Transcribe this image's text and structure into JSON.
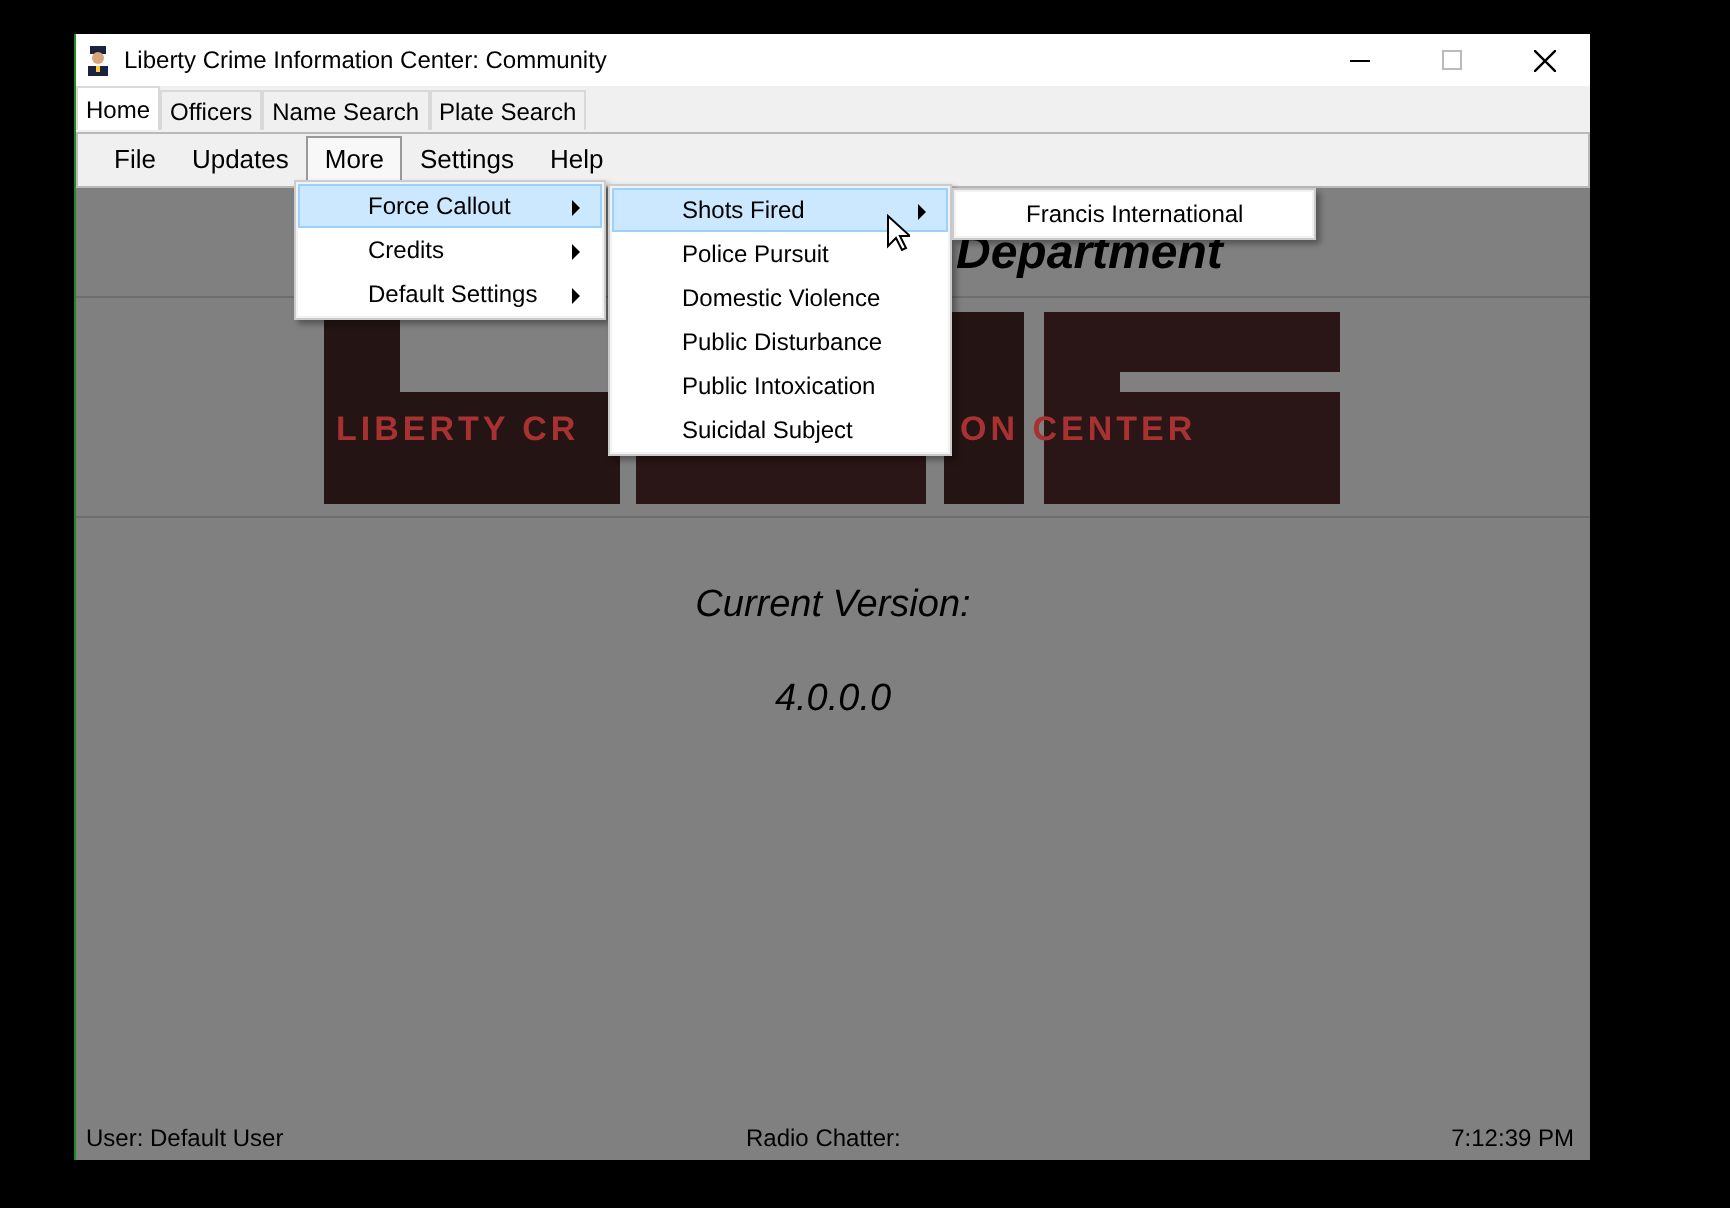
{
  "window": {
    "title": "Liberty Crime Information Center: Community"
  },
  "tabs": [
    {
      "label": "Home",
      "selected": true
    },
    {
      "label": "Officers",
      "selected": false
    },
    {
      "label": "Name Search",
      "selected": false
    },
    {
      "label": "Plate Search",
      "selected": false
    }
  ],
  "menubar": [
    {
      "label": "File",
      "selected": false
    },
    {
      "label": "Updates",
      "selected": false
    },
    {
      "label": "More",
      "selected": true
    },
    {
      "label": "Settings",
      "selected": false
    },
    {
      "label": "Help",
      "selected": false
    }
  ],
  "menus": [
    {
      "items": [
        {
          "label": "Force Callout",
          "has_submenu": true,
          "selected": true
        },
        {
          "label": "Credits",
          "has_submenu": true,
          "selected": false
        },
        {
          "label": "Default Settings",
          "has_submenu": true,
          "selected": false
        }
      ]
    },
    {
      "items": [
        {
          "label": "Shots Fired",
          "has_submenu": true,
          "selected": true
        },
        {
          "label": "Police Pursuit",
          "has_submenu": false,
          "selected": false
        },
        {
          "label": "Domestic Violence",
          "has_submenu": false,
          "selected": false
        },
        {
          "label": "Public Disturbance",
          "has_submenu": false,
          "selected": false
        },
        {
          "label": "Public Intoxication",
          "has_submenu": false,
          "selected": false
        },
        {
          "label": "Suicidal Subject",
          "has_submenu": false,
          "selected": false
        }
      ]
    },
    {
      "items": [
        {
          "label": "Francis International",
          "has_submenu": false,
          "selected": false
        }
      ]
    }
  ],
  "home": {
    "heading": "Department",
    "logo_text": [
      "LIBERTY CR",
      "ON CENTER"
    ],
    "version_label": "Current Version:",
    "version": "4.0.0.0"
  },
  "status_bar": {
    "user": "User: Default User",
    "radio": "Radio Chatter:",
    "time": "7:12:39 PM"
  }
}
